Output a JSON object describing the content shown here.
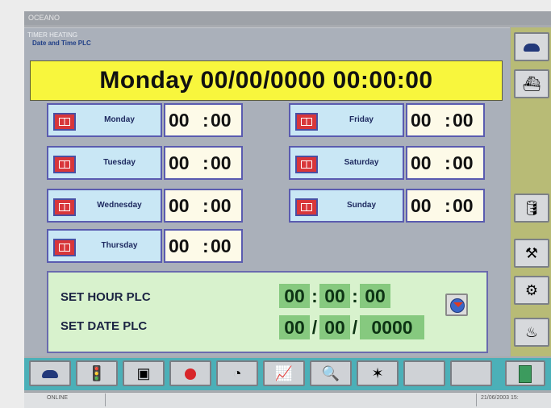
{
  "app": {
    "title": "OCEANO"
  },
  "window": {
    "title": "TIMER HEATING",
    "subtitle": "Date and Time PLC"
  },
  "banner": {
    "datetime": "Monday 00/00/0000  00:00:00"
  },
  "schedule": {
    "days": [
      {
        "name": "Monday",
        "hh": "00",
        "mm": "00"
      },
      {
        "name": "Tuesday",
        "hh": "00",
        "mm": "00"
      },
      {
        "name": "Wednesday",
        "hh": "00",
        "mm": "00"
      },
      {
        "name": "Thursday",
        "hh": "00",
        "mm": "00"
      },
      {
        "name": "Friday",
        "hh": "00",
        "mm": "00"
      },
      {
        "name": "Saturday",
        "hh": "00",
        "mm": "00"
      },
      {
        "name": "Sunday",
        "hh": "00",
        "mm": "00"
      }
    ],
    "separator": ":"
  },
  "set_panel": {
    "hour_label": "SET HOUR PLC",
    "date_label": "SET DATE PLC",
    "hour": {
      "hh": "00",
      "mm": "00",
      "ss": "00"
    },
    "date": {
      "dd": "00",
      "mo": "00",
      "yyyy": "0000"
    },
    "time_sep": ":",
    "date_sep": "/"
  },
  "sidebar": {
    "buttons": [
      "cloud-icon",
      "boat-icon",
      "canister-icon",
      "pump-icon",
      "pump2-icon",
      "water-icon"
    ]
  },
  "toolbar": {
    "buttons": [
      "cloud-icon",
      "traffic-light-icon",
      "photo-icon",
      "red-dot-icon",
      "gauge-icon",
      "chart-icon",
      "settings-icon",
      "alarm-icon",
      "blank",
      "exit-icon"
    ]
  },
  "status": {
    "mode": "ONLINE",
    "date": "21/06/2003  15:"
  },
  "colors": {
    "banner": "#f8f63d",
    "day_label": "#c9e7f5",
    "set_panel": "#d8f2cd",
    "toolbar": "#4bb0b8",
    "sidebar": "#b8bb76"
  }
}
